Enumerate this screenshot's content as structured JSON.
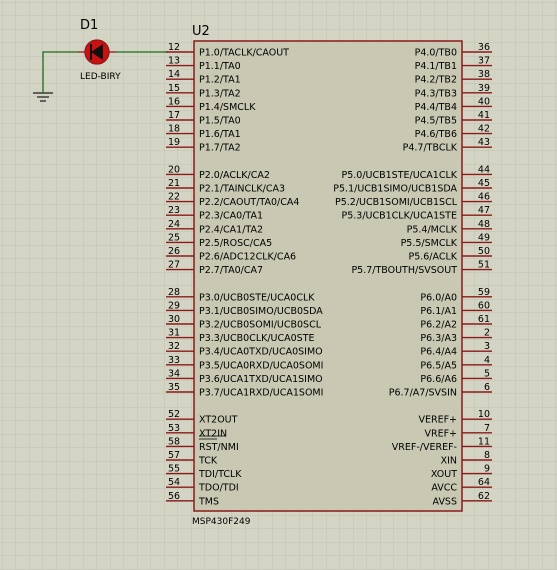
{
  "colors": {
    "background": "#d4d4c4",
    "grid": "#c2c2b2",
    "body_fill": "#c8c8b3",
    "body_stroke": "#8b1a1a",
    "pin": "#8b1a1a",
    "wire": "#1a6b1a",
    "led": "#cc1111"
  },
  "led": {
    "ref": "D1",
    "value": "LED-BIRY"
  },
  "chip": {
    "ref": "U2",
    "part": "MSP430F249",
    "left_pins": [
      {
        "num": "12",
        "label": "P1.0/TACLK/CAOUT"
      },
      {
        "num": "13",
        "label": "P1.1/TA0"
      },
      {
        "num": "14",
        "label": "P1.2/TA1"
      },
      {
        "num": "15",
        "label": "P1.3/TA2"
      },
      {
        "num": "16",
        "label": "P1.4/SMCLK"
      },
      {
        "num": "17",
        "label": "P1.5/TA0"
      },
      {
        "num": "18",
        "label": "P1.6/TA1"
      },
      {
        "num": "19",
        "label": "P1.7/TA2"
      },
      {
        "num": "20",
        "label": "P2.0/ACLK/CA2"
      },
      {
        "num": "21",
        "label": "P2.1/TAINCLK/CA3"
      },
      {
        "num": "22",
        "label": "P2.2/CAOUT/TA0/CA4"
      },
      {
        "num": "23",
        "label": "P2.3/CA0/TA1"
      },
      {
        "num": "24",
        "label": "P2.4/CA1/TA2"
      },
      {
        "num": "25",
        "label": "P2.5/ROSC/CA5"
      },
      {
        "num": "26",
        "label": "P2.6/ADC12CLK/CA6"
      },
      {
        "num": "27",
        "label": "P2.7/TA0/CA7"
      },
      {
        "num": "28",
        "label": "P3.0/UCB0STE/UCA0CLK"
      },
      {
        "num": "29",
        "label": "P3.1/UCB0SIMO/UCB0SDA"
      },
      {
        "num": "30",
        "label": "P3.2/UCB0SOMI/UCB0SCL"
      },
      {
        "num": "31",
        "label": "P3.3/UCB0CLK/UCA0STE"
      },
      {
        "num": "32",
        "label": "P3.4/UCA0TXD/UCA0SIMO"
      },
      {
        "num": "33",
        "label": "P3.5/UCA0RXD/UCA0SOMI"
      },
      {
        "num": "34",
        "label": "P3.6/UCA1TXD/UCA1SIMO"
      },
      {
        "num": "35",
        "label": "P3.7/UCA1RXD/UCA1SOMI"
      },
      {
        "num": "52",
        "label": "XT2OUT"
      },
      {
        "num": "53",
        "label": "XT2IN"
      },
      {
        "num": "58",
        "label": "RST/NMI"
      },
      {
        "num": "57",
        "label": "TCK"
      },
      {
        "num": "55",
        "label": "TDI/TCLK"
      },
      {
        "num": "54",
        "label": "TDO/TDI"
      },
      {
        "num": "56",
        "label": "TMS"
      }
    ],
    "right_pins": [
      {
        "num": "36",
        "label": "P4.0/TB0"
      },
      {
        "num": "37",
        "label": "P4.1/TB1"
      },
      {
        "num": "38",
        "label": "P4.2/TB2"
      },
      {
        "num": "39",
        "label": "P4.3/TB3"
      },
      {
        "num": "40",
        "label": "P4.4/TB4"
      },
      {
        "num": "41",
        "label": "P4.5/TB5"
      },
      {
        "num": "42",
        "label": "P4.6/TB6"
      },
      {
        "num": "43",
        "label": "P4.7/TBCLK"
      },
      {
        "num": "44",
        "label": "P5.0/UCB1STE/UCA1CLK"
      },
      {
        "num": "45",
        "label": "P5.1/UCB1SIMO/UCB1SDA"
      },
      {
        "num": "46",
        "label": "P5.2/UCB1SOMI/UCB1SCL"
      },
      {
        "num": "47",
        "label": "P5.3/UCB1CLK/UCA1STE"
      },
      {
        "num": "48",
        "label": "P5.4/MCLK"
      },
      {
        "num": "49",
        "label": "P5.5/SMCLK"
      },
      {
        "num": "50",
        "label": "P5.6/ACLK"
      },
      {
        "num": "51",
        "label": "P5.7/TBOUTH/SVSOUT"
      },
      {
        "num": "59",
        "label": "P6.0/A0"
      },
      {
        "num": "60",
        "label": "P6.1/A1"
      },
      {
        "num": "61",
        "label": "P6.2/A2"
      },
      {
        "num": "2",
        "label": "P6.3/A3"
      },
      {
        "num": "3",
        "label": "P6.4/A4"
      },
      {
        "num": "4",
        "label": "P6.5/A5"
      },
      {
        "num": "5",
        "label": "P6.6/A6"
      },
      {
        "num": "6",
        "label": "P6.7/A7/SVSIN"
      },
      {
        "num": "10",
        "label": "VEREF+"
      },
      {
        "num": "7",
        "label": "VREF+"
      },
      {
        "num": "11",
        "label": "VREF-/VEREF-"
      },
      {
        "num": "8",
        "label": "XIN"
      },
      {
        "num": "9",
        "label": "XOUT"
      },
      {
        "num": "64",
        "label": "AVCC"
      },
      {
        "num": "62",
        "label": "AVSS"
      }
    ]
  }
}
